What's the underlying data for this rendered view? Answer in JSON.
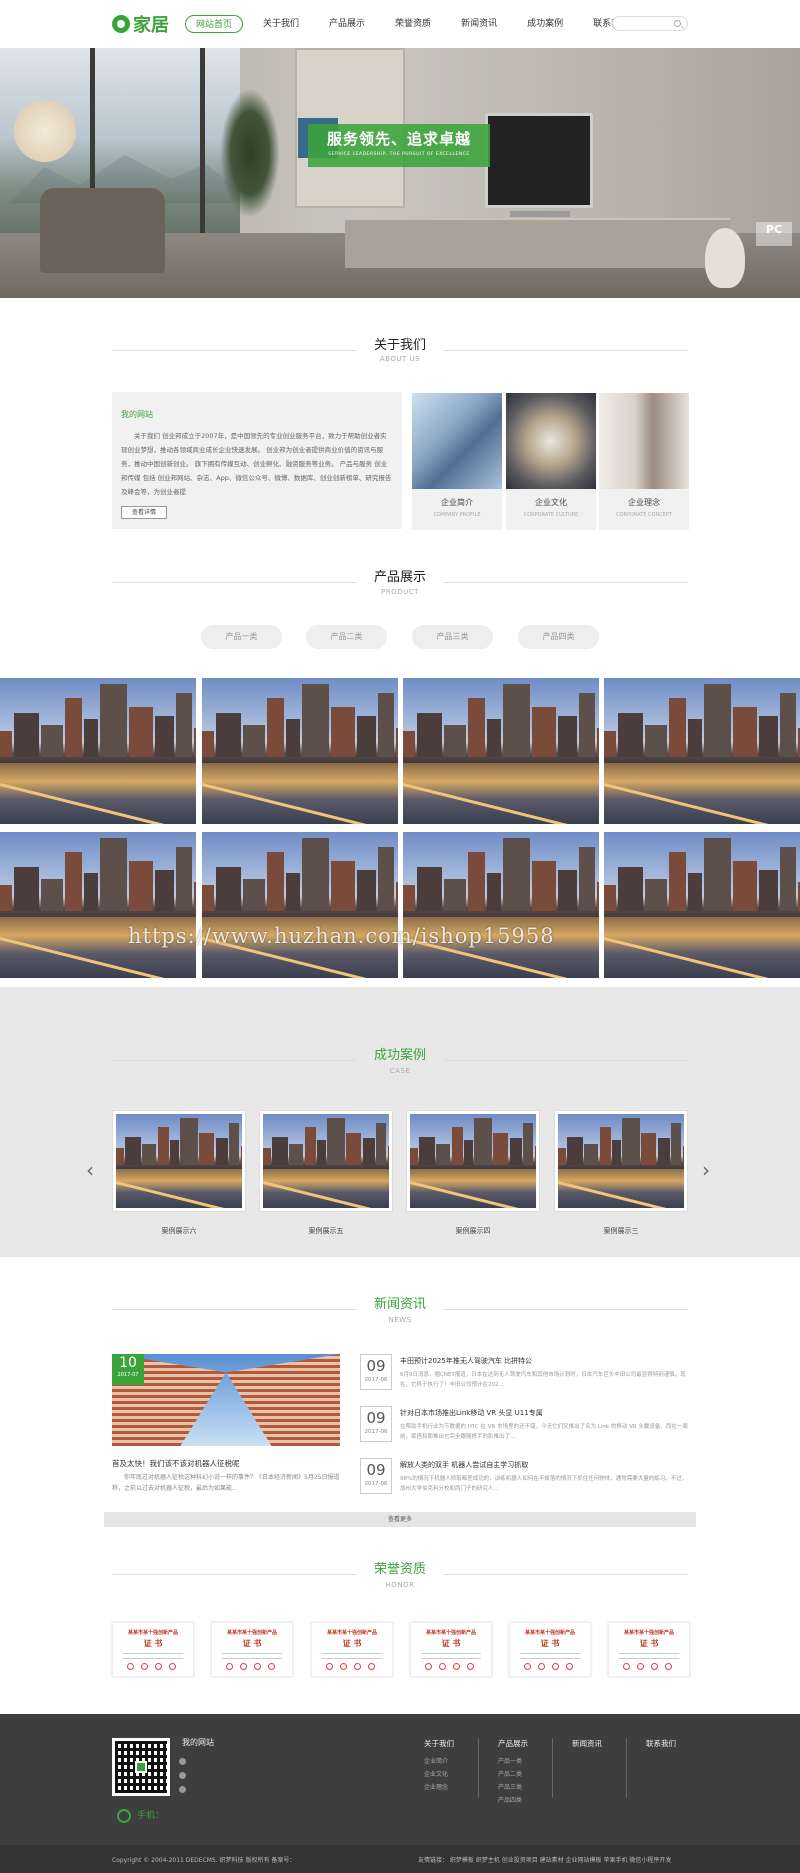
{
  "header": {
    "logo_text": "家居",
    "nav": [
      "网站首页",
      "关于我们",
      "产品展示",
      "荣誉资质",
      "新闻资讯",
      "成功案例",
      "联系我们"
    ],
    "search": {
      "placeholder": ""
    }
  },
  "banner": {
    "slogan": "服务领先、追求卓越",
    "slogan_en": "SERVICE LEADERSHIP, THE PURSUIT OF EXCELLENCE",
    "corner_mark": "PC"
  },
  "about": {
    "title_cn": "关于我们",
    "title_en": "ABOUT US",
    "box_heading": "我的网站",
    "box_text": "关于我们 创业邦成立于2007年，是中国领先的专业创业服务平台，致力于帮助创业者实现创业梦想，推动各领域商业成长企业快速发展。 创业邦为创业者提供商业价值的资讯与服务，推动中国创新创业。 旗下拥有传媒互动、创业孵化、融资服务等业务。 产品与服务 创业邦传媒 包括 创业邦网站、杂志、App、微信公众号、微博、数据库、创业创新榜单、研究报告及峰会等，为创业者提",
    "more_btn": "查看详情",
    "cards": [
      {
        "cn": "企业简介",
        "en": "COMPANY PROFILE"
      },
      {
        "cn": "企业文化",
        "en": "CORPORATE CULTURE"
      },
      {
        "cn": "企业理念",
        "en": "CORPORATE CONCEPT"
      }
    ]
  },
  "products": {
    "title_cn": "产品展示",
    "title_en": "PRODUCT",
    "tabs": [
      "产品一类",
      "产品二类",
      "产品三类",
      "产品四类"
    ]
  },
  "watermark": "https://www.huzhan.com/ishop15958",
  "cases": {
    "title_cn": "成功案例",
    "title_en": "CASE",
    "items": [
      "案例展示六",
      "案例展示五",
      "案例展示四",
      "案例展示三"
    ],
    "prev": "‹",
    "next": "›"
  },
  "news": {
    "title_cn": "新闻资讯",
    "title_en": "NEWS",
    "featured": {
      "day": "10",
      "month": "2017-07",
      "title": "首及太快！我们该不该对机器人征税呢",
      "text": "你年底过对机器人征税这种科幻小说一样的事件？《日本经济新闻》5月25日报道称，之前以过去对机器人征税，最后为如果能..."
    },
    "items": [
      {
        "day": "09",
        "month": "2017-06",
        "title": "丰田预计2025年推无人驾驶汽车 比拼特公",
        "text": "6月9日消息，据CNET报道，日本在达到无人驾驶汽车和其他市场计划时，日本汽车巨头丰田公司最显得特别谨慎。现在，它终于执行了！丰田公司预计在202..."
      },
      {
        "day": "09",
        "month": "2017-06",
        "title": "针对日本市场推出Link移动 VR 头显 U11专属",
        "text": "在帮助手机行业为节数据的 HTC 在 VR 市场里的还不错，今天它们又推出了名为 Link 的移动 VR 头戴设备，而在一周前，家搭和那推出它完全跟随携手的影推出了..."
      },
      {
        "day": "09",
        "month": "2017-06",
        "title": "解放人类的双手 机器人尝试自主学习抓取",
        "text": "98%的情况下机器人抓取都差成功的，训练机器人如何在不掉落的情况下抓住任何物体，通常需要大量的练习。不过，加州大学伯克利分校和西门子的研究人..."
      }
    ],
    "more": "查看更多"
  },
  "honor": {
    "title_cn": "荣誉资质",
    "title_en": "HONOR",
    "cert_heading": "某某市某十强创新产品",
    "cert_title": "证  书"
  },
  "footer": {
    "site_name": "我的网站",
    "phone_label": "手机：",
    "columns": [
      {
        "heading": "关于我们",
        "items": [
          "企业简介",
          "企业文化",
          "企业理念"
        ]
      },
      {
        "heading": "产品展示",
        "items": [
          "产品一类",
          "产品二类",
          "产品三类",
          "产品四类"
        ]
      },
      {
        "heading": "新闻资讯",
        "items": []
      },
      {
        "heading": "联系我们",
        "items": []
      }
    ],
    "copyright": "Copyright © 2004-2011 DEDECMS. 织梦科技 版权所有 备案号：",
    "links": "友情链接： 织梦模板 织梦主机 创业投资项目 建站素材 企业网站模板 苹果手机 微信小程序开发"
  },
  "colors": {
    "brand": "#3aa43a",
    "footer_bg": "#3e3e3e"
  }
}
